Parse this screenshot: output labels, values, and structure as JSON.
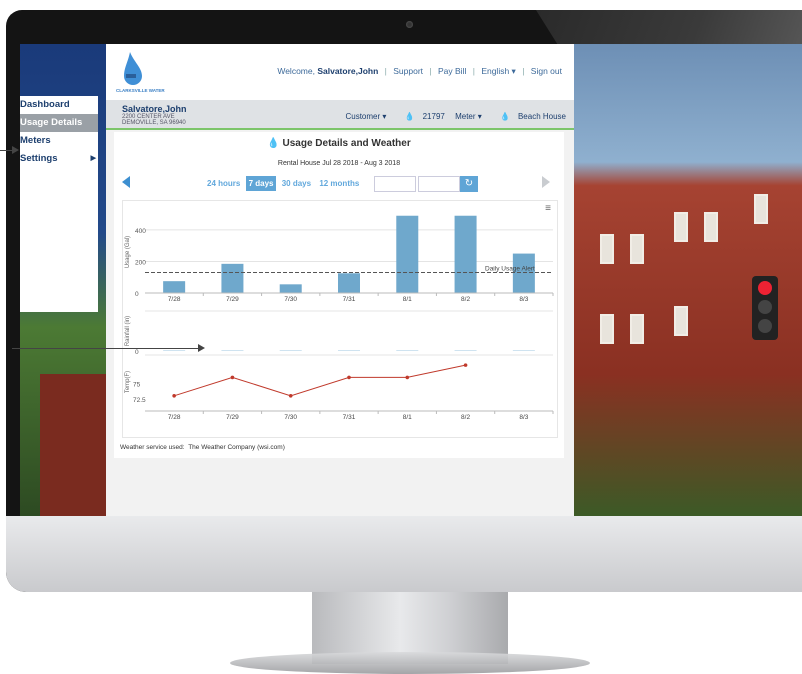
{
  "app": {
    "logo_text": "CLARKSVILLE WATER",
    "nav": {
      "welcome_label": "Welcome,",
      "user": "Salvatore,John",
      "support": "Support",
      "pay_bill": "Pay Bill",
      "language": "English ▾",
      "sign_out": "Sign out",
      "separator": "|"
    },
    "account": {
      "name": "Salvatore,John",
      "address_line1": "2200 CENTER AVE",
      "address_line2": "DEMOVILLE, SA 96940",
      "customer_label": "Customer ▾",
      "customer_value": "21797",
      "meter_label": "Meter ▾",
      "meter_value": "Beach House"
    }
  },
  "side_menu": {
    "items": [
      {
        "label": "Dashboard",
        "active": false
      },
      {
        "label": "Usage Details",
        "active": true
      },
      {
        "label": "Meters",
        "active": false
      },
      {
        "label": "Settings",
        "active": false
      }
    ]
  },
  "usage": {
    "title": "Usage Details and Weather",
    "subtitle": "Rental House  Jul 28 2018 - Aug 3 2018",
    "ranges": [
      {
        "label": "24 hours",
        "selected": false
      },
      {
        "label": "7 days",
        "selected": true
      },
      {
        "label": "30 days",
        "selected": false
      },
      {
        "label": "12 months",
        "selected": false
      }
    ],
    "weather_label": "Weather service used:",
    "weather_value": "The Weather Company (wsi.com)",
    "colors": {
      "bar": "#6fa8cc",
      "temp_line": "#c0392b",
      "accent": "#5fa5d6",
      "userbar_border": "#7cc56a"
    }
  },
  "chart_data": [
    {
      "type": "bar",
      "ylabel": "Usage (Gal)",
      "categories": [
        "7/28",
        "7/29",
        "7/30",
        "7/31",
        "8/1",
        "8/2",
        "8/3"
      ],
      "values": [
        75,
        185,
        55,
        125,
        490,
        490,
        250
      ],
      "ylim": [
        0,
        520
      ],
      "yticks": [
        0,
        200,
        400
      ],
      "reference_line": {
        "label": "Daily Usage Alert",
        "value": 130
      }
    },
    {
      "type": "bar",
      "ylabel": "Rainfall (in)",
      "categories": [
        "7/28",
        "7/29",
        "7/30",
        "7/31",
        "8/1",
        "8/2",
        "8/3"
      ],
      "values": [
        0,
        0,
        0,
        0,
        0,
        0,
        0
      ],
      "yticks": [
        0
      ]
    },
    {
      "type": "line",
      "ylabel": "Temp(F)",
      "categories": [
        "7/28",
        "7/29",
        "7/30",
        "7/31",
        "8/1",
        "8/2",
        "8/3"
      ],
      "values": [
        73,
        76,
        73,
        76,
        76,
        78,
        null
      ],
      "ylim": [
        71.5,
        79
      ],
      "yticks": [
        72.5,
        75
      ]
    }
  ]
}
